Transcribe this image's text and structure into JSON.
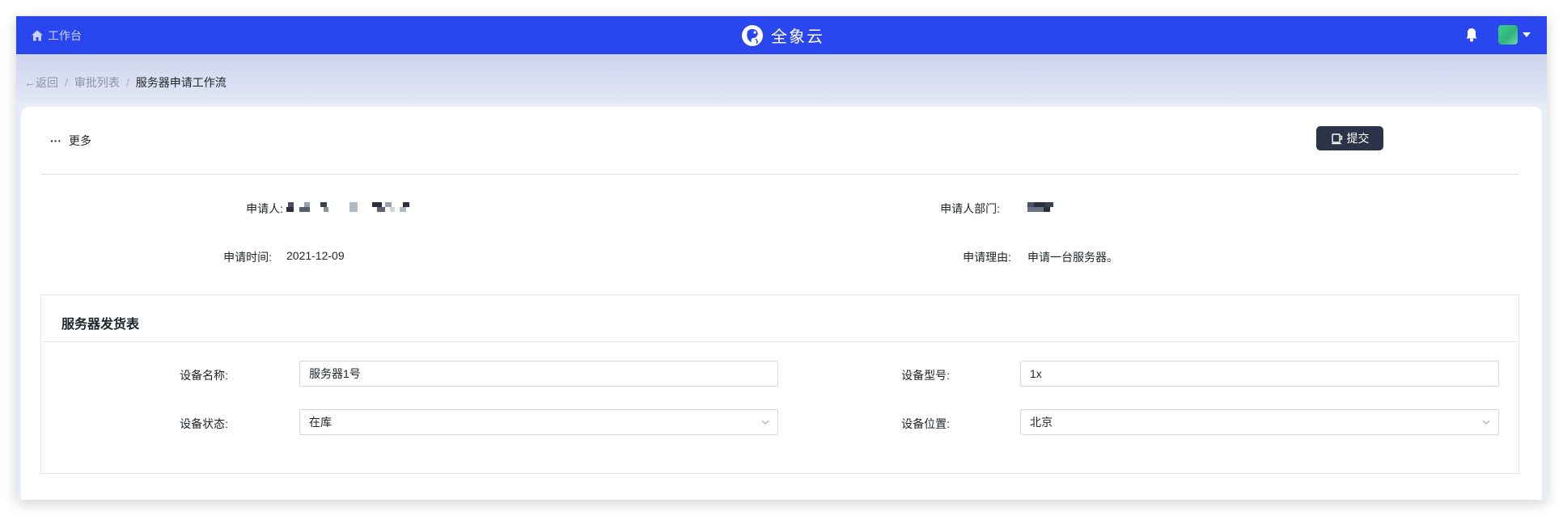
{
  "topbar": {
    "home_label": "工作台",
    "brand_name": "全象云",
    "bg_color": "#2a46ef"
  },
  "breadcrumb": {
    "back": "←返回",
    "list": "审批列表",
    "current": "服务器申请工作流",
    "separator": "/"
  },
  "toolbar": {
    "more_dots": "···",
    "more_label": "更多",
    "submit_label": "提交"
  },
  "info": {
    "applicant_label": "申请人:",
    "applicant_value": "",
    "department_label": "申请人部门:",
    "department_value": "",
    "time_label": "申请时间:",
    "time_value": "2021-12-09",
    "reason_label": "申请理由:",
    "reason_value": "申请一台服务器。"
  },
  "form": {
    "title": "服务器发货表",
    "device_name_label": "设备名称:",
    "device_name_value": "服务器1号",
    "device_model_label": "设备型号:",
    "device_model_value": "1x",
    "device_status_label": "设备状态:",
    "device_status_value": "在库",
    "device_location_label": "设备位置:",
    "device_location_value": "北京"
  },
  "icons": {
    "home": "home-icon",
    "logo": "brand-logo-icon",
    "bell": "bell-icon",
    "submit": "submit-icon",
    "chevron": "chevron-down-icon"
  }
}
